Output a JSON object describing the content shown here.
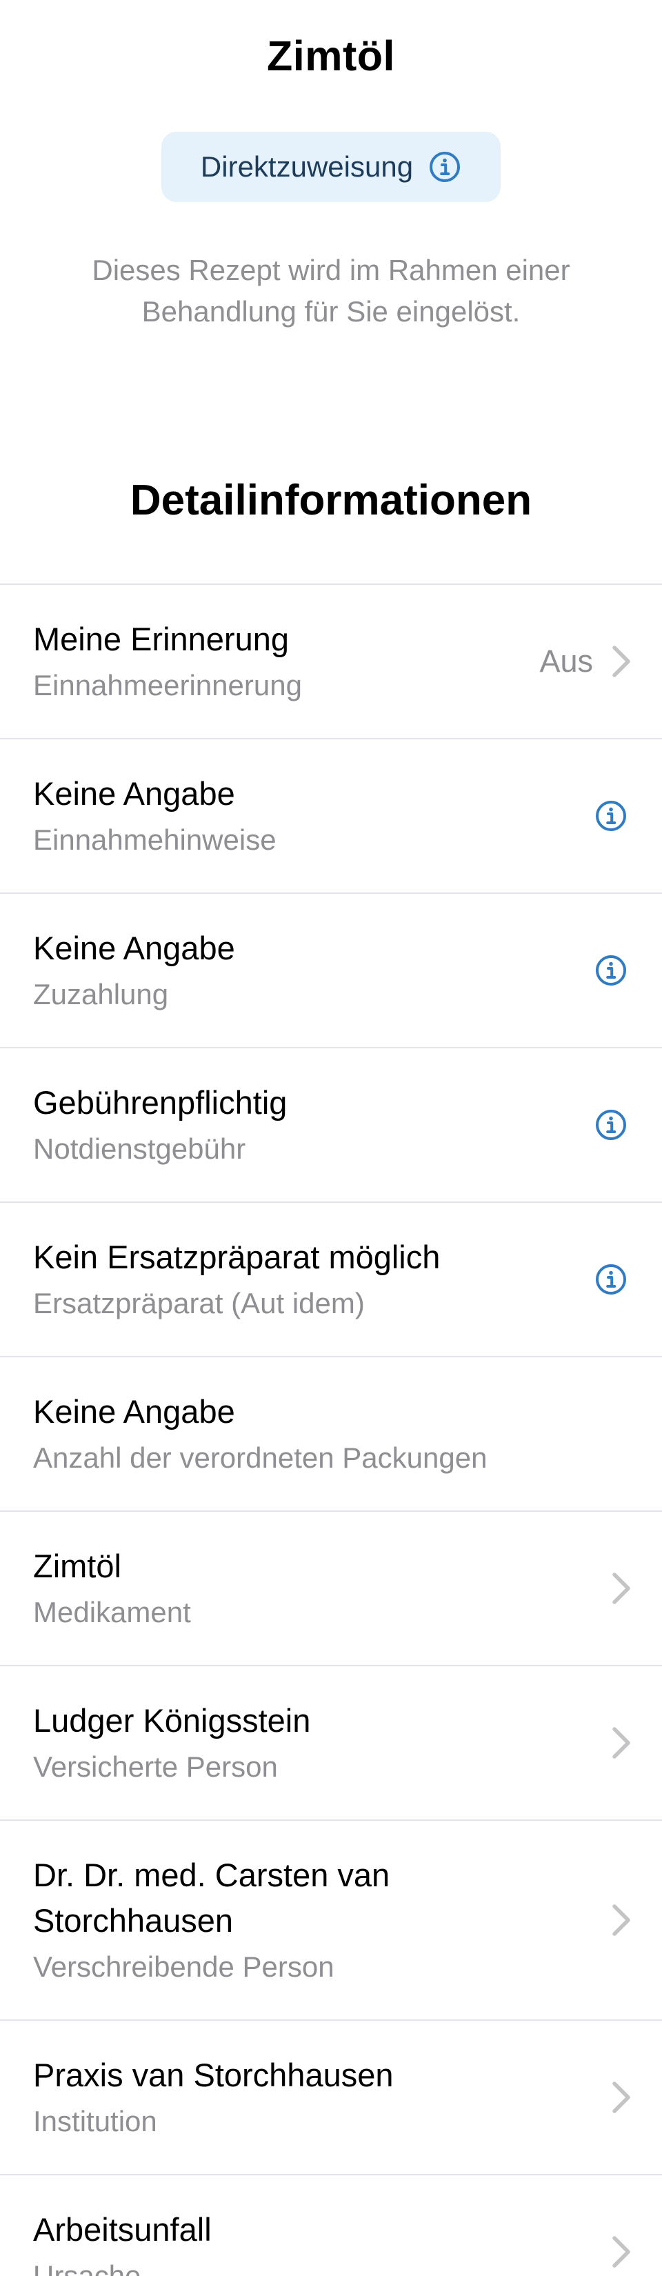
{
  "header": {
    "title": "Zimtöl",
    "chip_label": "Direktzuweisung",
    "subtitle_line1": "Dieses Rezept wird im Rahmen einer",
    "subtitle_line2": "Behandlung für Sie eingelöst."
  },
  "section": {
    "title": "Detailinformationen"
  },
  "rows": [
    {
      "title": "Meine Erinnerung",
      "subtitle": "Einnahmeerinnerung",
      "value": "Aus"
    },
    {
      "title": "Keine Angabe",
      "subtitle": "Einnahmehinweise"
    },
    {
      "title": "Keine Angabe",
      "subtitle": "Zuzahlung"
    },
    {
      "title": "Gebührenpflichtig",
      "subtitle": "Notdienstgebühr"
    },
    {
      "title": "Kein Ersatzpräparat möglich",
      "subtitle": "Ersatzpräparat (Aut idem)"
    },
    {
      "title": "Keine Angabe",
      "subtitle": "Anzahl der verordneten Packungen"
    },
    {
      "title": "Zimtöl",
      "subtitle": "Medikament"
    },
    {
      "title": "Ludger Königsstein",
      "subtitle": "Versicherte Person"
    },
    {
      "title_line1": "Dr. Dr. med. Carsten van",
      "title_line2": "Storchhausen",
      "subtitle": "Verschreibende Person"
    },
    {
      "title": "Praxis van Storchhausen",
      "subtitle": "Institution"
    },
    {
      "title": "Arbeitsunfall",
      "subtitle": "Ursache"
    }
  ],
  "icons": {
    "info": "info-circle-icon",
    "chevron": "chevron-right-icon"
  },
  "colors": {
    "accent": "#2f7bc4",
    "chip_background": "#e5f1fb",
    "secondary_text": "#8e8e93",
    "separator": "#e3e3e8"
  }
}
